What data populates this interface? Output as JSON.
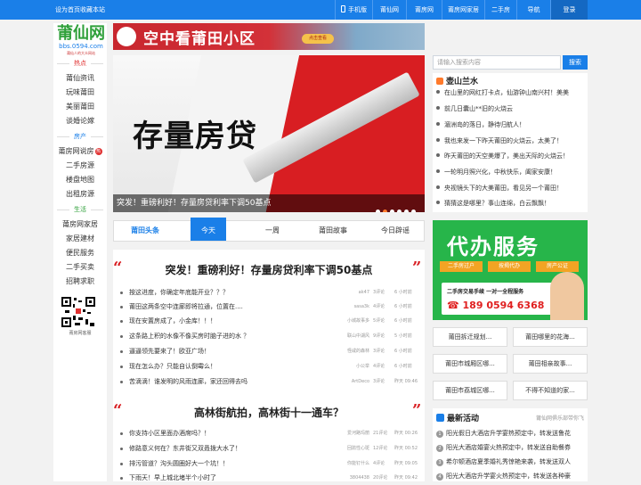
{
  "topbar": {
    "left_links": [
      "设为首页",
      "收藏本站"
    ],
    "nav": [
      "手机版",
      "莆仙网",
      "莆房网",
      "莆房网家居",
      "二手房",
      "导航",
      "登录"
    ]
  },
  "logo": {
    "name": "莆仙网",
    "url": "bbs.0594.com",
    "slogan": "莆仙人的大众网站"
  },
  "sidebar": {
    "sections": [
      {
        "title": "热点",
        "items": [
          "莆仙资讯",
          "玩味莆田",
          "美丽莆田",
          "谈婚论嫁"
        ]
      },
      {
        "title": "房产",
        "items": [
          "莆房网说房",
          "二手房源",
          "楼盘地图",
          "出租房源"
        ]
      },
      {
        "title": "生活",
        "items": [
          "莆房网家居",
          "家居建材",
          "便民服务",
          "二手买卖",
          "招聘求职"
        ]
      }
    ],
    "hot_badge": "热",
    "qr_caption": "莆房网客服"
  },
  "top_ad": {
    "text": "空中看莆田小区",
    "button": "点击查看"
  },
  "banner": {
    "headline": "存量房贷",
    "caption": "突发！重磅利好！存量房贷利率下调50基点",
    "slides": 6,
    "active_slide": 1
  },
  "tabs": [
    "莆田头条",
    "今天",
    "一周",
    "莆田故事",
    "今日辟谣"
  ],
  "feed": {
    "sections": [
      {
        "title": "突发！重磅利好！存量房贷利率下调50基点",
        "rows": [
          {
            "t": "按这进度，你确定年底能开业？？？",
            "a": "ak47",
            "c": "3评论",
            "d": "6 小时前"
          },
          {
            "t": "莆田这两条空中连廊即将拉通，位置在....",
            "a": "sasa3k",
            "c": "4评论",
            "d": "6 小时前"
          },
          {
            "t": "现在安置房成了，小金库！！！",
            "a": "小城故事多",
            "c": "5评论",
            "d": "6 小时前"
          },
          {
            "t": "这条路上积的水像不像买房时脑子进的水 ？",
            "a": "联山中湖风",
            "c": "9评论",
            "d": "5 小时前"
          },
          {
            "t": "逼逼领先要来了！欧亚广场！",
            "a": "怪咸的森林",
            "c": "3评论",
            "d": "6 小时前"
          },
          {
            "t": "现在怎么办？只能自认倒霉么！",
            "a": "小公举",
            "c": "4评论",
            "d": "6 小时前"
          },
          {
            "t": "苦滴滴！谁发明的风雨连廊，家还回得去吗",
            "a": "ArtDeco",
            "c": "3评论",
            "d": "昨天 09:46"
          }
        ]
      },
      {
        "title": "高林街航拍，高林街十一通车？",
        "rows": [
          {
            "t": "你支持小区里面办酒席吗？！",
            "a": "爱河路玛丽",
            "c": "21评论",
            "d": "昨天 00:26"
          },
          {
            "t": "修路意义何在？东井街又双叒拨大水了！",
            "a": "回鹃性心斑",
            "c": "12评论",
            "d": "昨天 00:52"
          },
          {
            "t": "排污管道？沟头圆圈好大一个坑！！",
            "a": "你能钉什么",
            "c": "4评论",
            "d": "昨天 09:05"
          },
          {
            "t": "下雨天！早上城北堵半个小时了",
            "a": "3804438",
            "c": "20评论",
            "d": "昨天 09:42"
          }
        ]
      }
    ]
  },
  "search": {
    "placeholder": "请输入搜索内容",
    "button": "搜索"
  },
  "right_box": {
    "title": "壶山兰水",
    "items": [
      "在山里的网红打卡点，仙游钟山南兴村！美美",
      "前几日囊山**旧的火烧云",
      "湄洲岛的落日，静待归航人！",
      "我也来发一下昨天莆田的火烧云，太美了！",
      "昨天莆田的天空美爆了，美出天际的火烧云！",
      "一轮明月照兴化，中秋快乐，阖家安康！",
      "央视镜头下的大美莆田，看见另一个莆田！",
      "猜猜这是哪里？事山连绵，白云飘飘！"
    ]
  },
  "service_ad": {
    "title": "代办服务",
    "tags": [
      "二手房过户",
      "按揭代办",
      "房产公证"
    ],
    "line1": "二手房交易手续 一对一全程服务",
    "phone": "189 0594 6368"
  },
  "quick_buttons": [
    "莆田拆迁规划...",
    "莆田哪里的花海...",
    "莆田市城厢区哪...",
    "莆田相亲故事...",
    "莆田市荔城区哪...",
    "不得不知道的家..."
  ],
  "events": {
    "title": "最新活动",
    "more": "莆仙网俱乐部带你飞",
    "items": [
      "阳光假日大酒店升学宴热预定中，转发送鲁花",
      "阳光大酒店婚宴火热预定中，转发送自助餐券",
      "希尔顿酒店夏季婚礼秀惊艳来袭，转发送双人",
      "阳光大酒店升学宴火热预定中，转发送各种豪"
    ]
  },
  "colors": {
    "brand_blue": "#1a7fe8",
    "accent_red": "#d81e22",
    "accent_orange": "#ff7a2b",
    "green": "#27b54a"
  }
}
